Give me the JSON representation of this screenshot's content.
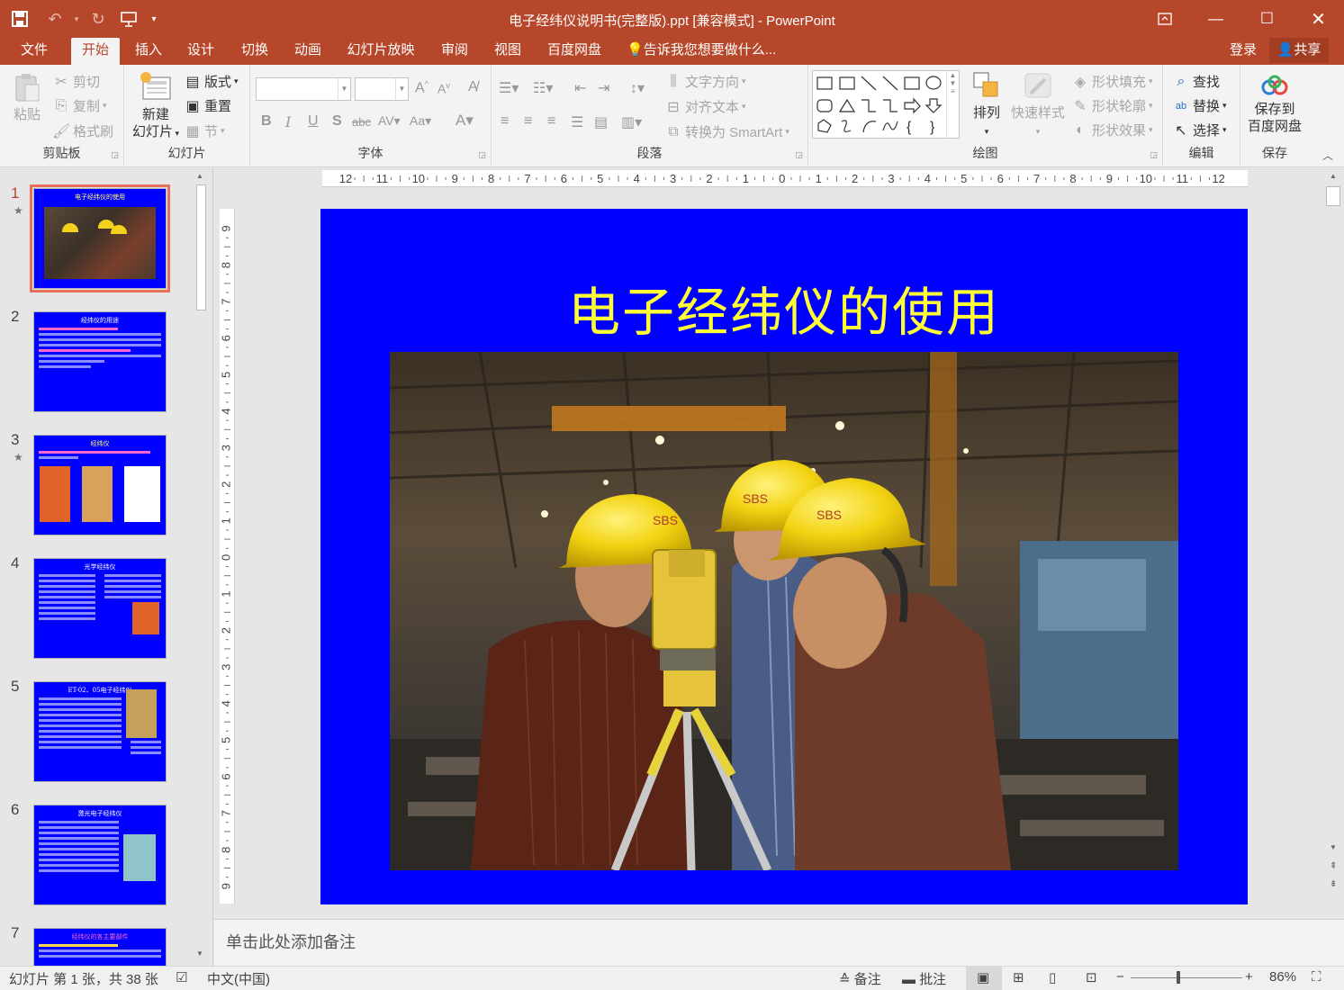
{
  "window": {
    "title": "电子经纬仪说明书(完整版).ppt [兼容模式] - PowerPoint"
  },
  "tabs": [
    "文件",
    "开始",
    "插入",
    "设计",
    "切换",
    "动画",
    "幻灯片放映",
    "审阅",
    "视图",
    "百度网盘"
  ],
  "active_tab": "开始",
  "tell_me": "告诉我您想要做什么...",
  "account": {
    "login": "登录",
    "share": "共享"
  },
  "ribbon": {
    "clipboard": {
      "label": "剪贴板",
      "paste": "粘贴",
      "cut": "剪切",
      "copy": "复制",
      "format_painter": "格式刷"
    },
    "slides": {
      "label": "幻灯片",
      "new_slide_line1": "新建",
      "new_slide_line2": "幻灯片",
      "layout": "版式",
      "reset": "重置",
      "section": "节"
    },
    "font": {
      "label": "字体",
      "font_name": "",
      "font_size": ""
    },
    "paragraph": {
      "label": "段落",
      "text_direction": "文字方向",
      "align_text": "对齐文本",
      "smartart": "转换为 SmartArt"
    },
    "drawing": {
      "label": "绘图",
      "arrange": "排列",
      "quick_styles": "快速样式",
      "shape_fill": "形状填充",
      "shape_outline": "形状轮廓",
      "shape_effects": "形状效果"
    },
    "editing": {
      "label": "编辑",
      "find": "查找",
      "replace": "替换",
      "select": "选择"
    },
    "save": {
      "label": "保存",
      "save_to_line1": "保存到",
      "save_to_line2": "百度网盘"
    }
  },
  "thumbnails": [
    {
      "num": "1",
      "star": true,
      "title": "电子经纬仪的使用"
    },
    {
      "num": "2",
      "star": false,
      "title": "经纬仪的用途"
    },
    {
      "num": "3",
      "star": true,
      "title": "经纬仪"
    },
    {
      "num": "4",
      "star": false,
      "title": "光学经纬仪"
    },
    {
      "num": "5",
      "star": false,
      "title": "ET-02、05电子经纬仪"
    },
    {
      "num": "6",
      "star": false,
      "title": "激光电子经纬仪"
    },
    {
      "num": "7",
      "star": false,
      "title": "经纬仪的各主要部件"
    }
  ],
  "ruler": {
    "horizontal": [
      "12",
      "11",
      "10",
      "9",
      "8",
      "7",
      "6",
      "5",
      "4",
      "3",
      "2",
      "1",
      "0",
      "1",
      "2",
      "3",
      "4",
      "5",
      "6",
      "7",
      "8",
      "9",
      "10",
      "11",
      "12"
    ],
    "vertical": [
      "9",
      "8",
      "7",
      "6",
      "5",
      "4",
      "3",
      "2",
      "1",
      "0",
      "1",
      "2",
      "3",
      "4",
      "5",
      "6",
      "7",
      "8",
      "9"
    ]
  },
  "slide": {
    "title": "电子经纬仪的使用",
    "bg_color": "#0000fe",
    "title_color": "#ffff33"
  },
  "notes_placeholder": "单击此处添加备注",
  "status": {
    "slide_info": "幻灯片 第 1 张，共 38 张",
    "language": "中文(中国)",
    "notes_btn": "备注",
    "comments_btn": "批注",
    "zoom": "86%",
    "zoom_fraction": 0.43
  }
}
